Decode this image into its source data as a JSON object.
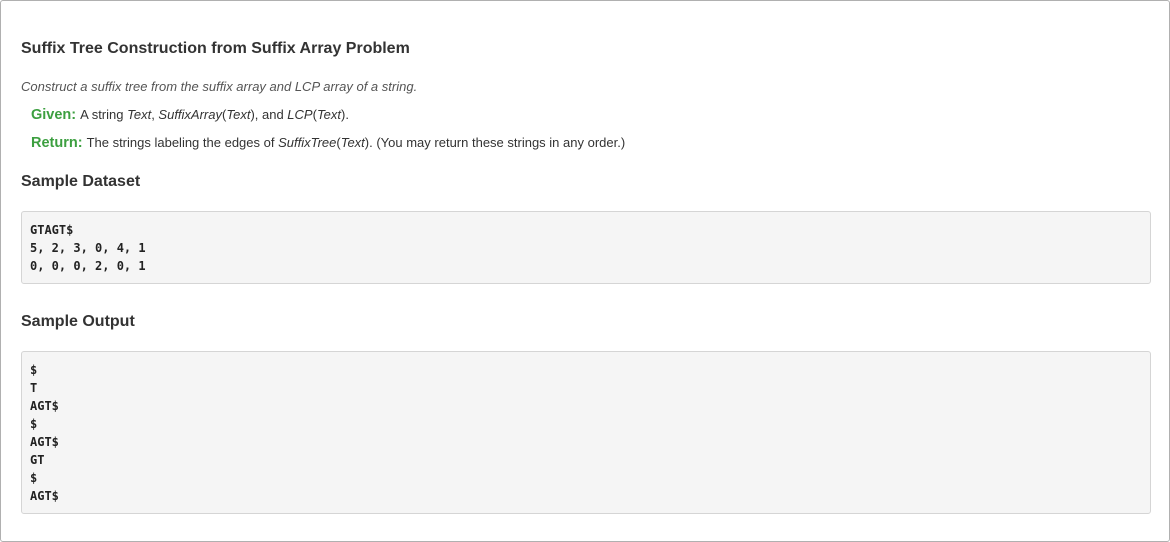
{
  "problem": {
    "title": "Suffix Tree Construction from Suffix Array Problem",
    "description": "Construct a suffix tree from the suffix array and LCP array of a string.",
    "given": {
      "label": "Given:",
      "t1": "A string ",
      "text1": "Text",
      "t2": ", ",
      "sa": "SuffixArray",
      "p1": "(",
      "text2": "Text",
      "p2": "), and ",
      "lcp": "LCP",
      "p3": "(",
      "text3": "Text",
      "p4": ")."
    },
    "return": {
      "label": "Return:",
      "t1": "The strings labeling the edges of ",
      "st": "SuffixTree",
      "p1": "(",
      "text": "Text",
      "p2": "). (You may return these strings in any order.)"
    }
  },
  "sample_dataset": {
    "heading": "Sample Dataset",
    "lines": [
      "GTAGT$",
      "5, 2, 3, 0, 4, 1",
      "0, 0, 0, 2, 0, 1"
    ]
  },
  "sample_output": {
    "heading": "Sample Output",
    "lines": [
      "$",
      "T",
      "AGT$",
      "$",
      "AGT$",
      "GT",
      "$",
      "AGT$"
    ]
  }
}
